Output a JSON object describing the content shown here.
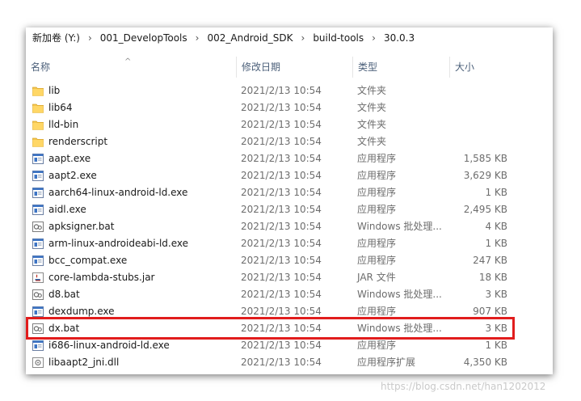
{
  "breadcrumb": [
    "新加卷 (Y:)",
    "001_DevelopTools",
    "002_Android_SDK",
    "build-tools",
    "30.0.3"
  ],
  "columns": {
    "name": "名称",
    "date": "修改日期",
    "type": "类型",
    "size": "大小"
  },
  "files": [
    {
      "name": "lib",
      "date": "2021/2/13 10:54",
      "type": "文件夹",
      "size": "",
      "icon": "folder-icon"
    },
    {
      "name": "lib64",
      "date": "2021/2/13 10:54",
      "type": "文件夹",
      "size": "",
      "icon": "folder-icon"
    },
    {
      "name": "lld-bin",
      "date": "2021/2/13 10:54",
      "type": "文件夹",
      "size": "",
      "icon": "folder-icon"
    },
    {
      "name": "renderscript",
      "date": "2021/2/13 10:54",
      "type": "文件夹",
      "size": "",
      "icon": "folder-icon"
    },
    {
      "name": "aapt.exe",
      "date": "2021/2/13 10:54",
      "type": "应用程序",
      "size": "1,585 KB",
      "icon": "exe-icon"
    },
    {
      "name": "aapt2.exe",
      "date": "2021/2/13 10:54",
      "type": "应用程序",
      "size": "3,629 KB",
      "icon": "exe-icon"
    },
    {
      "name": "aarch64-linux-android-ld.exe",
      "date": "2021/2/13 10:54",
      "type": "应用程序",
      "size": "1 KB",
      "icon": "exe-icon"
    },
    {
      "name": "aidl.exe",
      "date": "2021/2/13 10:54",
      "type": "应用程序",
      "size": "2,495 KB",
      "icon": "exe-icon"
    },
    {
      "name": "apksigner.bat",
      "date": "2021/2/13 10:54",
      "type": "Windows 批处理...",
      "size": "4 KB",
      "icon": "bat-icon"
    },
    {
      "name": "arm-linux-androideabi-ld.exe",
      "date": "2021/2/13 10:54",
      "type": "应用程序",
      "size": "1 KB",
      "icon": "exe-icon"
    },
    {
      "name": "bcc_compat.exe",
      "date": "2021/2/13 10:54",
      "type": "应用程序",
      "size": "247 KB",
      "icon": "exe-icon"
    },
    {
      "name": "core-lambda-stubs.jar",
      "date": "2021/2/13 10:54",
      "type": "JAR 文件",
      "size": "18 KB",
      "icon": "jar-icon"
    },
    {
      "name": "d8.bat",
      "date": "2021/2/13 10:54",
      "type": "Windows 批处理...",
      "size": "3 KB",
      "icon": "bat-icon"
    },
    {
      "name": "dexdump.exe",
      "date": "2021/2/13 10:54",
      "type": "应用程序",
      "size": "907 KB",
      "icon": "exe-icon"
    },
    {
      "name": "dx.bat",
      "date": "2021/2/13 10:54",
      "type": "Windows 批处理...",
      "size": "3 KB",
      "icon": "bat-icon"
    },
    {
      "name": "i686-linux-android-ld.exe",
      "date": "2021/2/13 10:54",
      "type": "应用程序",
      "size": "1 KB",
      "icon": "exe-icon"
    },
    {
      "name": "libaapt2_jni.dll",
      "date": "2021/2/13 10:54",
      "type": "应用程序扩展",
      "size": "4,350 KB",
      "icon": "dll-icon"
    }
  ],
  "highlight_color": "#e11d1d",
  "watermark": "https://blog.csdn.net/han1202012"
}
